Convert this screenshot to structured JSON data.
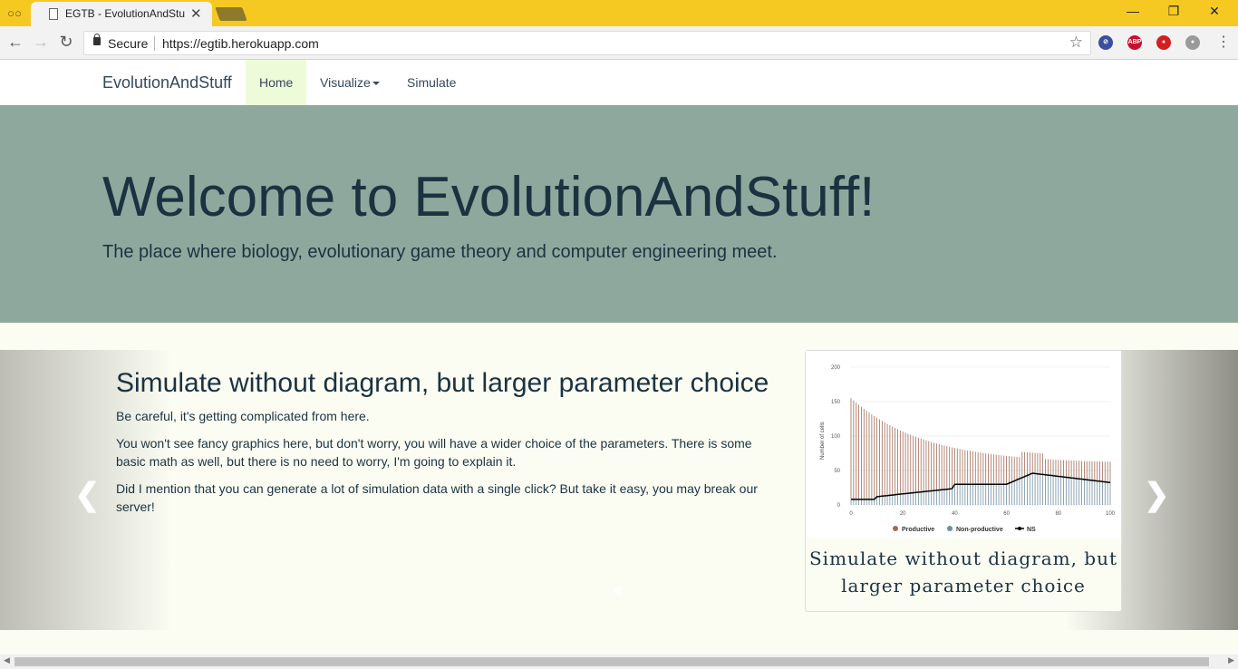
{
  "browser": {
    "tab_title": "EGTB - EvolutionAndStuff",
    "secure_label": "Secure",
    "url": "https://egtib.herokuapp.com"
  },
  "nav": {
    "brand": "EvolutionAndStuff",
    "items": [
      {
        "label": "Home",
        "active": true
      },
      {
        "label": "Visualize",
        "dropdown": true
      },
      {
        "label": "Simulate"
      }
    ]
  },
  "hero": {
    "title": "Welcome to EvolutionAndStuff!",
    "subtitle": "The place where biology, evolutionary game theory and computer engineering meet."
  },
  "slide": {
    "heading": "Simulate without diagram, but larger parameter choice",
    "paragraphs": [
      "Be careful, it's getting complicated from here.",
      "You won't see fancy graphics here, but don't worry, you will have a wider choice of the parameters. There is some basic math as well, but there is no need to worry, I'm going to explain it.",
      "Did I mention that you can generate a lot of simulation data with a single click? But take it easy, you may break our server!"
    ],
    "card_caption": "Simulate without diagram, but larger parameter choice",
    "chart": {
      "ylabel": "Number of cells",
      "y_ticks": [
        "0",
        "50",
        "100",
        "150",
        "200"
      ],
      "x_ticks": [
        "0",
        "20",
        "40",
        "60",
        "80",
        "100"
      ],
      "legend": [
        "Productive",
        "Non-productive",
        "NS"
      ],
      "colors": {
        "productive": "#a06a54",
        "nonproductive": "#6f8ea3",
        "ns": "#000000"
      }
    }
  }
}
